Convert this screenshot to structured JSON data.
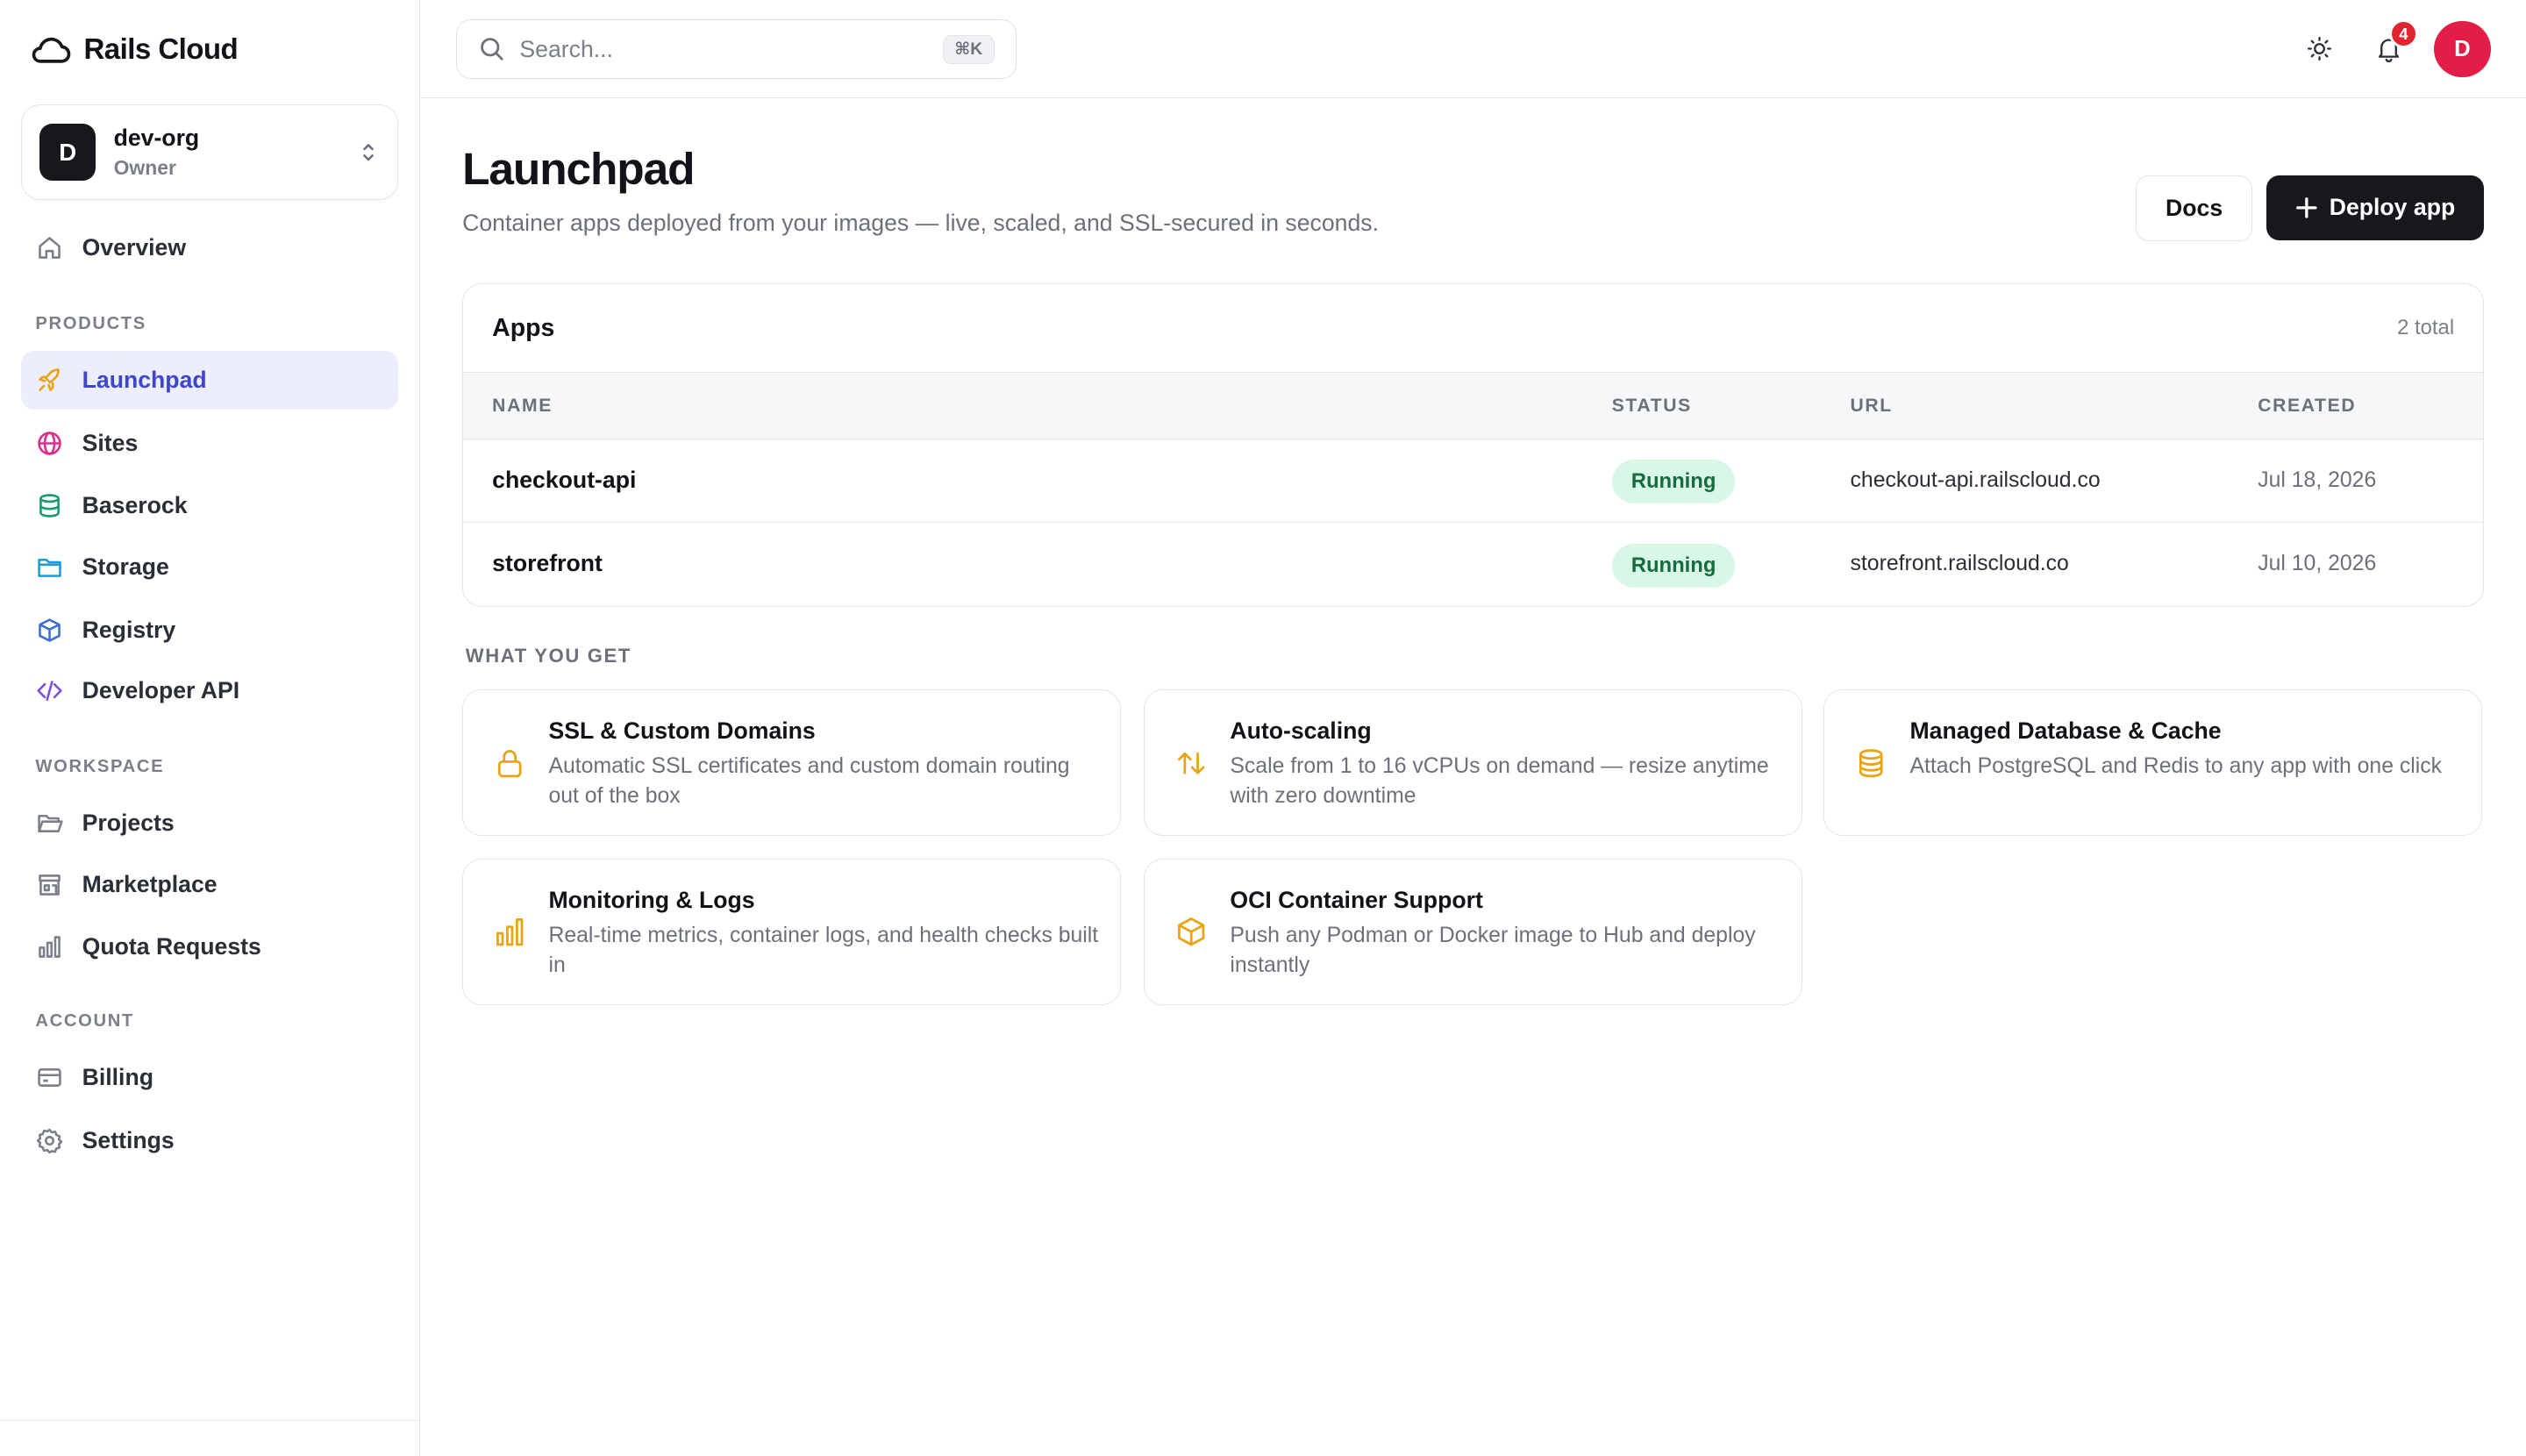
{
  "brand": {
    "name": "Rails Cloud"
  },
  "org": {
    "initial": "D",
    "name": "dev-org",
    "role": "Owner"
  },
  "sidebar": {
    "overview": "Overview",
    "products_label": "PRODUCTS",
    "products": [
      {
        "label": "Launchpad",
        "icon": "rocket-icon",
        "active": true
      },
      {
        "label": "Sites",
        "icon": "globe-icon"
      },
      {
        "label": "Baserock",
        "icon": "database-icon"
      },
      {
        "label": "Storage",
        "icon": "folder-icon"
      },
      {
        "label": "Registry",
        "icon": "box-icon"
      },
      {
        "label": "Developer API",
        "icon": "code-icon"
      }
    ],
    "workspace_label": "WORKSPACE",
    "workspace": [
      {
        "label": "Projects",
        "icon": "folder-open-icon"
      },
      {
        "label": "Marketplace",
        "icon": "store-icon"
      },
      {
        "label": "Quota Requests",
        "icon": "bar-chart-icon"
      }
    ],
    "account_label": "ACCOUNT",
    "account": [
      {
        "label": "Billing",
        "icon": "credit-card-icon"
      },
      {
        "label": "Settings",
        "icon": "gear-icon"
      }
    ]
  },
  "topbar": {
    "search_placeholder": "Search...",
    "shortcut": "⌘K",
    "notification_count": "4",
    "user_initial": "D"
  },
  "page": {
    "title": "Launchpad",
    "subtitle": "Container apps deployed from your images — live, scaled, and SSL-secured in seconds.",
    "docs_button": "Docs",
    "deploy_button": "Deploy app"
  },
  "apps": {
    "title": "Apps",
    "count": "2 total",
    "columns": [
      "NAME",
      "STATUS",
      "URL",
      "CREATED"
    ],
    "rows": [
      {
        "name": "checkout-api",
        "status": "Running",
        "url": "checkout-api.railscloud.co",
        "created": "Jul 18, 2026"
      },
      {
        "name": "storefront",
        "status": "Running",
        "url": "storefront.railscloud.co",
        "created": "Jul 10, 2026"
      }
    ]
  },
  "features": {
    "label": "WHAT YOU GET",
    "items": [
      {
        "title": "SSL & Custom Domains",
        "desc": "Automatic SSL certificates and custom domain routing out of the box",
        "icon": "lock-icon"
      },
      {
        "title": "Auto-scaling",
        "desc": "Scale from 1 to 16 vCPUs on demand — resize anytime with zero downtime",
        "icon": "arrows-up-down-icon"
      },
      {
        "title": "Managed Database & Cache",
        "desc": "Attach PostgreSQL and Redis to any app with one click",
        "icon": "database-icon"
      },
      {
        "title": "Monitoring & Logs",
        "desc": "Real-time metrics, container logs, and health checks built in",
        "icon": "bar-chart-icon"
      },
      {
        "title": "OCI Container Support",
        "desc": "Push any Podman or Docker image to Hub and deploy instantly",
        "icon": "package-icon"
      }
    ]
  },
  "colors": {
    "accent": "#3f46c9",
    "accent_bg": "#eceefe",
    "primary_button": "#16181d",
    "status_running_bg": "#d9f7e6",
    "status_running_text": "#176c3f",
    "feature_icon": "#e8a317",
    "avatar": "#e11d48",
    "badge": "#e02430"
  }
}
